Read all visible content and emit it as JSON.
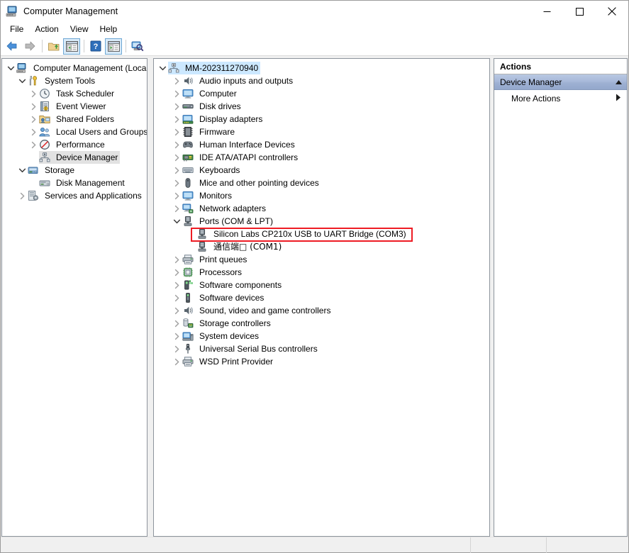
{
  "window": {
    "title": "Computer Management",
    "app_icon": "computer-management-icon",
    "caption": {
      "minimize": "minimize-icon",
      "maximize": "maximize-icon",
      "close": "close-icon"
    }
  },
  "menubar": {
    "items": [
      {
        "label": "File",
        "name": "menu-file"
      },
      {
        "label": "Action",
        "name": "menu-action"
      },
      {
        "label": "View",
        "name": "menu-view"
      },
      {
        "label": "Help",
        "name": "menu-help"
      }
    ]
  },
  "toolbar": {
    "buttons": [
      {
        "name": "back-button",
        "icon": "back-arrow-icon",
        "pressed": false
      },
      {
        "name": "forward-button",
        "icon": "forward-arrow-icon",
        "pressed": false
      },
      {
        "name": "up-one-level-button",
        "icon": "folder-up-icon",
        "pressed": false
      },
      {
        "name": "show-hide-console-tree-button",
        "icon": "console-tree-icon",
        "pressed": true
      },
      {
        "name": "help-button",
        "icon": "question-mark-icon",
        "pressed": false
      },
      {
        "name": "show-hide-action-pane-button",
        "icon": "action-pane-icon",
        "pressed": true
      },
      {
        "name": "scan-for-hardware-changes-button",
        "icon": "scan-hardware-icon",
        "pressed": false
      }
    ]
  },
  "console_tree": {
    "nodes": [
      {
        "label": "Computer Management (Local)",
        "indent": 0,
        "expander": "collapse",
        "icon": "computer-management-icon",
        "selected": "none"
      },
      {
        "label": "System Tools",
        "indent": 1,
        "expander": "collapse",
        "icon": "system-tools-icon",
        "selected": "none"
      },
      {
        "label": "Task Scheduler",
        "indent": 2,
        "expander": "expand",
        "icon": "clock-icon",
        "selected": "none"
      },
      {
        "label": "Event Viewer",
        "indent": 2,
        "expander": "expand",
        "icon": "event-viewer-icon",
        "selected": "none"
      },
      {
        "label": "Shared Folders",
        "indent": 2,
        "expander": "expand",
        "icon": "shared-folders-icon",
        "selected": "none"
      },
      {
        "label": "Local Users and Groups",
        "indent": 2,
        "expander": "expand",
        "icon": "users-groups-icon",
        "selected": "none"
      },
      {
        "label": "Performance",
        "indent": 2,
        "expander": "expand",
        "icon": "performance-icon",
        "selected": "none"
      },
      {
        "label": "Device Manager",
        "indent": 2,
        "expander": "none",
        "icon": "device-manager-icon",
        "selected": "inactive"
      },
      {
        "label": "Storage",
        "indent": 1,
        "expander": "collapse",
        "icon": "storage-icon",
        "selected": "none"
      },
      {
        "label": "Disk Management",
        "indent": 2,
        "expander": "none",
        "icon": "disk-management-icon",
        "selected": "none"
      },
      {
        "label": "Services and Applications",
        "indent": 1,
        "expander": "expand",
        "icon": "services-apps-icon",
        "selected": "none"
      }
    ]
  },
  "device_tree": {
    "nodes": [
      {
        "label": "MM-202311270940",
        "indent": 0,
        "expander": "collapse",
        "icon": "computer-node-icon",
        "selected": "active"
      },
      {
        "label": "Audio inputs and outputs",
        "indent": 1,
        "expander": "expand",
        "icon": "speaker-icon",
        "selected": "none"
      },
      {
        "label": "Computer",
        "indent": 1,
        "expander": "expand",
        "icon": "monitor-icon",
        "selected": "none"
      },
      {
        "label": "Disk drives",
        "indent": 1,
        "expander": "expand",
        "icon": "disk-drive-icon",
        "selected": "none"
      },
      {
        "label": "Display adapters",
        "indent": 1,
        "expander": "expand",
        "icon": "display-adapter-icon",
        "selected": "none"
      },
      {
        "label": "Firmware",
        "indent": 1,
        "expander": "expand",
        "icon": "firmware-chip-icon",
        "selected": "none"
      },
      {
        "label": "Human Interface Devices",
        "indent": 1,
        "expander": "expand",
        "icon": "gamepad-icon",
        "selected": "none"
      },
      {
        "label": "IDE ATA/ATAPI controllers",
        "indent": 1,
        "expander": "expand",
        "icon": "ide-controller-icon",
        "selected": "none"
      },
      {
        "label": "Keyboards",
        "indent": 1,
        "expander": "expand",
        "icon": "keyboard-icon",
        "selected": "none"
      },
      {
        "label": "Mice and other pointing devices",
        "indent": 1,
        "expander": "expand",
        "icon": "mouse-icon",
        "selected": "none"
      },
      {
        "label": "Monitors",
        "indent": 1,
        "expander": "expand",
        "icon": "monitor-icon",
        "selected": "none"
      },
      {
        "label": "Network adapters",
        "indent": 1,
        "expander": "expand",
        "icon": "network-adapter-icon",
        "selected": "none"
      },
      {
        "label": "Ports (COM & LPT)",
        "indent": 1,
        "expander": "collapse",
        "icon": "port-icon",
        "selected": "none"
      },
      {
        "label": "Silicon Labs CP210x USB to UART Bridge (COM3)",
        "indent": 2,
        "expander": "none",
        "icon": "port-icon",
        "selected": "none",
        "annotated": true
      },
      {
        "label": "通信端□ (COM1)",
        "indent": 2,
        "expander": "none",
        "icon": "port-icon",
        "selected": "none",
        "cjk": true
      },
      {
        "label": "Print queues",
        "indent": 1,
        "expander": "expand",
        "icon": "printer-icon",
        "selected": "none"
      },
      {
        "label": "Processors",
        "indent": 1,
        "expander": "expand",
        "icon": "processor-icon",
        "selected": "none"
      },
      {
        "label": "Software components",
        "indent": 1,
        "expander": "expand",
        "icon": "software-component-icon",
        "selected": "none"
      },
      {
        "label": "Software devices",
        "indent": 1,
        "expander": "expand",
        "icon": "software-device-icon",
        "selected": "none"
      },
      {
        "label": "Sound, video and game controllers",
        "indent": 1,
        "expander": "expand",
        "icon": "speaker-icon",
        "selected": "none"
      },
      {
        "label": "Storage controllers",
        "indent": 1,
        "expander": "expand",
        "icon": "storage-controller-icon",
        "selected": "none"
      },
      {
        "label": "System devices",
        "indent": 1,
        "expander": "expand",
        "icon": "system-device-icon",
        "selected": "none"
      },
      {
        "label": "Universal Serial Bus controllers",
        "indent": 1,
        "expander": "expand",
        "icon": "usb-icon",
        "selected": "none"
      },
      {
        "label": "WSD Print Provider",
        "indent": 1,
        "expander": "expand",
        "icon": "printer-icon",
        "selected": "none"
      }
    ]
  },
  "actions_pane": {
    "header": "Actions",
    "group_title": "Device Manager",
    "group_chevron": "chevron-up-icon",
    "rows": [
      {
        "label": "More Actions",
        "arrow": "triangle-right-icon",
        "name": "actions-more-actions"
      }
    ]
  },
  "statusbar": {
    "cell1": "",
    "cell2": "",
    "cell3": ""
  },
  "colors": {
    "annotation": "#ee1c24",
    "selection_active": "#cce8ff",
    "selection_inactive": "#e2e2e2",
    "actions_group_band": "#a9bada",
    "toolbar_pressed": "#d9ebf9"
  }
}
